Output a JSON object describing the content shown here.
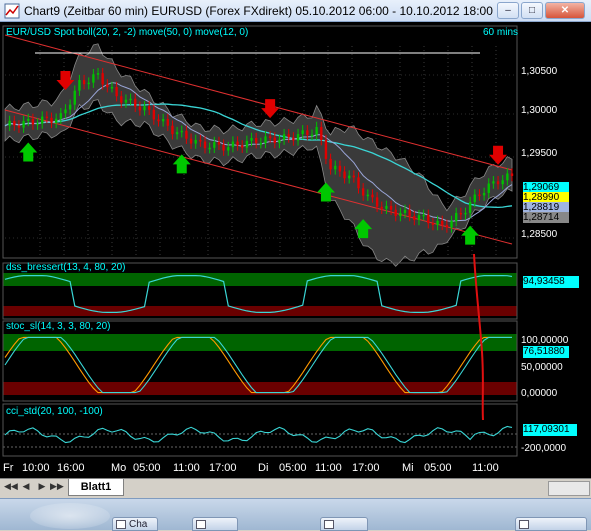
{
  "window": {
    "title": "Chart9 (Zeitbar 60 min)  EURUSD (Forex FXdirekt) 05.10.2012 06:00 - 10.10.2012 18:00"
  },
  "main_chart": {
    "label": "EUR/USD Spot boll(20, 2, -2) move(50, 0) move(12, 0)",
    "timeframe": "60 mins",
    "y_ticks": [
      "1,30500",
      "1,30000",
      "1,29500",
      "1,28500"
    ],
    "price_tags": [
      "1,29069",
      "1,28990",
      "1,28819",
      "1,28714"
    ]
  },
  "panel_dss": {
    "label": "dss_bressert(13, 4, 80, 20)",
    "value": "94,93458"
  },
  "panel_stoc": {
    "label": "stoc_sl(14, 3, 3, 80, 20)",
    "y_ticks": [
      "100,00000",
      "50,00000",
      "0,00000"
    ],
    "value": "76,51880"
  },
  "panel_cci": {
    "label": "cci_std(20, 100, -100)",
    "y_ticks": [
      "-200,0000"
    ],
    "value": "117,09301"
  },
  "x_axis": {
    "labels": [
      "Fr",
      "10:00",
      "16:00",
      "Mo",
      "05:00",
      "11:00",
      "17:00",
      "Di",
      "05:00",
      "11:00",
      "17:00",
      "Mi",
      "05:00",
      "11:00"
    ]
  },
  "sheet_tabs": {
    "active": "Blatt1"
  },
  "taskbar": {
    "items": [
      "Cha",
      "",
      "",
      ""
    ]
  },
  "colors": {
    "background": "#000000",
    "up_candle": "#00c000",
    "down_candle": "#e00000",
    "up_arrow": "#00c800",
    "down_arrow": "#e00000",
    "label_text": "#00ffff",
    "upper_zone": "#006400",
    "lower_zone": "#6a0000"
  },
  "arrows": {
    "down": [
      0.12,
      0.52,
      0.97
    ],
    "up": [
      0.05,
      0.35,
      0.63,
      0.71,
      0.92
    ]
  }
}
